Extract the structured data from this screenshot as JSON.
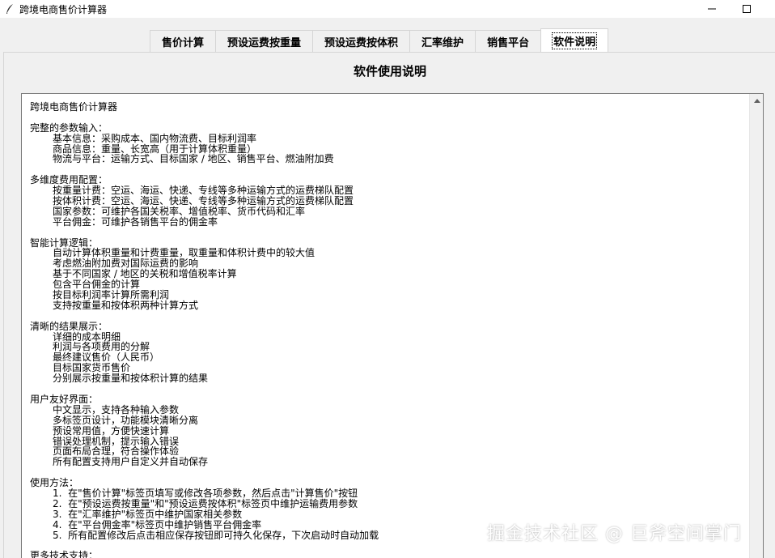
{
  "window": {
    "title": "跨境电商售价计算器"
  },
  "tabs": [
    {
      "label": "售价计算"
    },
    {
      "label": "预设运费按重量"
    },
    {
      "label": "预设运费按体积"
    },
    {
      "label": "汇率维护"
    },
    {
      "label": "销售平台"
    },
    {
      "label": "软件说明"
    }
  ],
  "active_tab": "软件说明",
  "page": {
    "title": "软件使用说明"
  },
  "doc": {
    "heading": "跨境电商售价计算器",
    "sections": [
      {
        "title": "完整的参数输入：",
        "items": [
          "基本信息：采购成本、国内物流费、目标利润率",
          "商品信息：重量、长宽高（用于计算体积重量）",
          "物流与平台：运输方式、目标国家 / 地区、销售平台、燃油附加费"
        ]
      },
      {
        "title": "多维度费用配置：",
        "items": [
          "按重量计费：空运、海运、快递、专线等多种运输方式的运费梯队配置",
          "按体积计费：空运、海运、快递、专线等多种运输方式的运费梯队配置",
          "国家参数：可维护各国关税率、增值税率、货币代码和汇率",
          "平台佣金：可维护各销售平台的佣金率"
        ]
      },
      {
        "title": "智能计算逻辑：",
        "items": [
          "自动计算体积重量和计费重量，取重量和体积计费中的较大值",
          "考虑燃油附加费对国际运费的影响",
          "基于不同国家 / 地区的关税和增值税率计算",
          "包含平台佣金的计算",
          "按目标利润率计算所需利润",
          "支持按重量和按体积两种计算方式"
        ]
      },
      {
        "title": "清晰的结果展示：",
        "items": [
          "详细的成本明细",
          "利润与各项费用的分解",
          "最终建议售价（人民币）",
          "目标国家货币售价",
          "分别展示按重量和按体积计算的结果"
        ]
      },
      {
        "title": "用户友好界面：",
        "items": [
          "中文显示，支持各种输入参数",
          "多标签页设计，功能模块清晰分离",
          "预设常用值，方便快速计算",
          "错误处理机制，提示输入错误",
          "页面布局合理，符合操作体验",
          "所有配置支持用户自定义并自动保存"
        ]
      },
      {
        "title": "使用方法：",
        "items": [
          "1.  在\"售价计算\"标签页填写或修改各项参数，然后点击\"计算售价\"按钮",
          "2.  在\"预设运费按重量\"和\"预设运费按体积\"标签页中维护运输费用参数",
          "3.  在\"汇率维护\"标签页中维护国家相关参数",
          "4.  在\"平台佣金率\"标签页中维护销售平台佣金率",
          "5.  所有配置修改后点击相应保存按钮即可持久化保存，下次启动时自动加载"
        ]
      },
      {
        "title": "更多技术支持：",
        "items": []
      }
    ]
  },
  "watermark": "掘金技术社区 @ 巨斧空间掌门"
}
